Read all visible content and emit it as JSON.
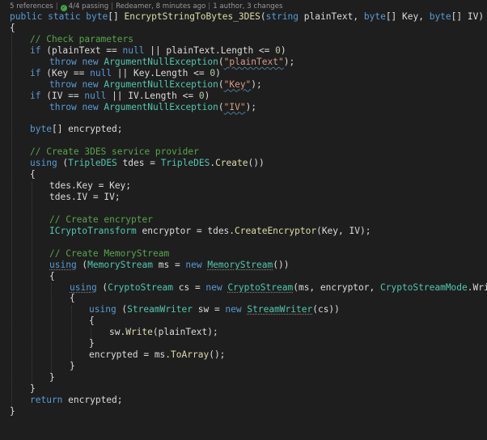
{
  "codelens": {
    "references": "5 references",
    "tests": "4/4 passing",
    "author": "Redeamer, 8 minutes ago",
    "changes": "1 author, 3 changes"
  },
  "colors": {
    "background": "#1e1e1e",
    "keyword": "#569cd6",
    "type": "#4ec9b0",
    "method": "#dcdcaa",
    "comment": "#57a64a",
    "string": "#d69d85",
    "number": "#b5cea8",
    "text": "#dcdcdc",
    "test_passing": "#3aa845"
  },
  "code": {
    "l1": {
      "a": "public static ",
      "b": "byte",
      "c": "[] ",
      "d": "EncryptStringToBytes_3DES",
      "e": "(",
      "f": "string",
      "g": " plainText, ",
      "h": "byte",
      "i": "[] Key, ",
      "j": "byte",
      "k": "[] IV)"
    },
    "l2": "{",
    "l3": "// Check parameters",
    "l4": {
      "a": "if",
      "b": " (plainText == ",
      "c": "null",
      "d": " || plainText.Length <= ",
      "e": "0",
      "f": ")"
    },
    "l5": {
      "a": "throw",
      "b": " ",
      "c": "new",
      "d": " ",
      "e": "ArgumentNullException",
      "f": "(",
      "g": "\"plainText\"",
      "h": ");"
    },
    "l6": {
      "a": "if",
      "b": " (Key == ",
      "c": "null",
      "d": " || Key.Length <= ",
      "e": "0",
      "f": ")"
    },
    "l7": {
      "a": "throw",
      "b": " ",
      "c": "new",
      "d": " ",
      "e": "ArgumentNullException",
      "f": "(",
      "g": "\"Key\"",
      "h": ");"
    },
    "l8": {
      "a": "if",
      "b": " (IV == ",
      "c": "null",
      "d": " || IV.Length <= ",
      "e": "0",
      "f": ")"
    },
    "l9": {
      "a": "throw",
      "b": " ",
      "c": "new",
      "d": " ",
      "e": "ArgumentNullException",
      "f": "(",
      "g": "\"IV\"",
      "h": ");"
    },
    "l11": {
      "a": "byte",
      "b": "[] encrypted;"
    },
    "l13": "// Create 3DES service provider",
    "l14": {
      "a": "using",
      "b": " (",
      "c": "TripleDES",
      "d": " tdes = ",
      "e": "TripleDES",
      "f": ".",
      "g": "Create",
      "h": "())"
    },
    "l15": "{",
    "l16": "tdes.Key = Key;",
    "l17": "tdes.IV = IV;",
    "l19": "// Create encrypter",
    "l20": {
      "a": "ICryptoTransform",
      "b": " encryptor = tdes.",
      "c": "CreateEncryptor",
      "d": "(Key, IV);"
    },
    "l22": "// Create MemoryStream",
    "l23": {
      "a": "using",
      "b": " (",
      "c": "MemoryStream",
      "d": " ms = ",
      "e": "new",
      "f": " ",
      "g": "MemoryStream",
      "h": "())"
    },
    "l24": "{",
    "l25": {
      "a": "using",
      "b": " (",
      "c": "CryptoStream",
      "d": " cs = ",
      "e": "new",
      "f": " ",
      "g": "CryptoStream",
      "h": "(ms, encryptor, ",
      "i": "CryptoStreamMode",
      "j": ".Write))"
    },
    "l26": "{",
    "l27": {
      "a": "using",
      "b": " (",
      "c": "StreamWriter",
      "d": " sw = ",
      "e": "new",
      "f": " ",
      "g": "StreamWriter",
      "h": "(cs))"
    },
    "l28": "{",
    "l29": {
      "a": "sw.",
      "b": "Write",
      "c": "(plainText);"
    },
    "l30": "}",
    "l31": {
      "a": "encrypted = ms.",
      "b": "ToArray",
      "c": "();"
    },
    "l32": "}",
    "l33": "}",
    "l34": "}",
    "l35": {
      "a": "return",
      "b": " encrypted;"
    },
    "l36": "}"
  }
}
